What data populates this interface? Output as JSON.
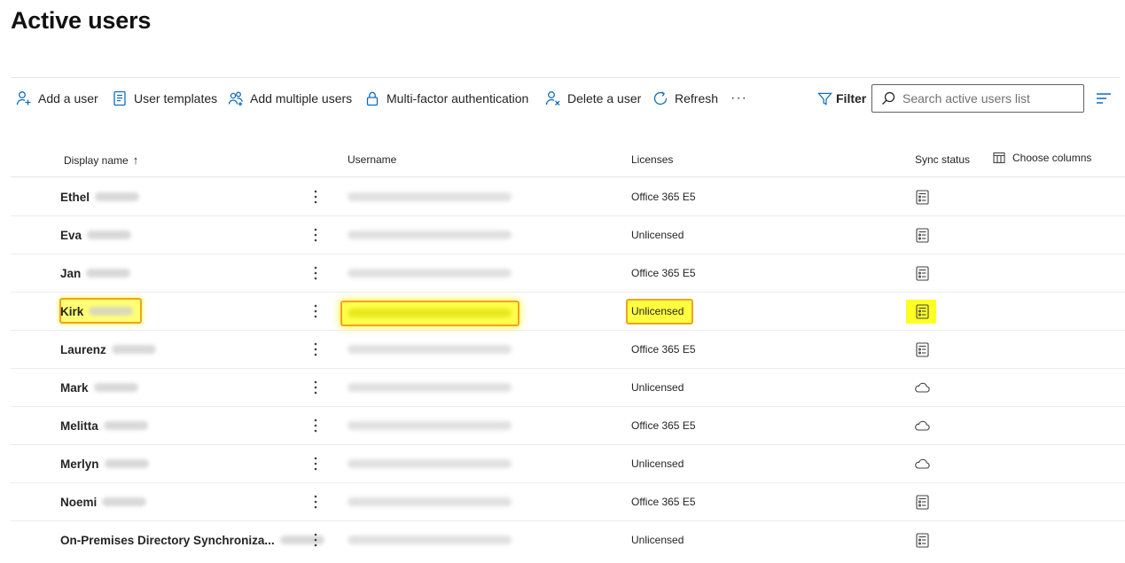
{
  "page": {
    "title": "Active users"
  },
  "toolbar": {
    "add_user": {
      "label": "Add a user",
      "icon": "add-person-icon"
    },
    "user_templates": {
      "label": "User templates",
      "icon": "template-icon"
    },
    "add_multiple": {
      "label": "Add multiple users",
      "icon": "people-add-icon"
    },
    "mfa": {
      "label": "Multi-factor authentication",
      "icon": "lock-icon"
    },
    "delete_user": {
      "label": "Delete a user",
      "icon": "person-delete-icon"
    },
    "refresh": {
      "label": "Refresh",
      "icon": "refresh-icon"
    },
    "more": {
      "label": "···",
      "icon": "more-icon"
    },
    "filter": {
      "label": "Filter",
      "icon": "filter-icon"
    },
    "search": {
      "placeholder": "Search active users list",
      "value": ""
    },
    "view": {
      "icon": "list-view-icon"
    }
  },
  "table": {
    "columns": {
      "display_name": "Display name",
      "sort_indicator": "↑",
      "username": "Username",
      "licenses": "Licenses",
      "sync_status": "Sync status",
      "choose_columns": "Choose columns"
    },
    "rows": [
      {
        "name": "Ethel",
        "license": "Office 365 E5",
        "sync": "directory-synced-icon",
        "highlighted": false
      },
      {
        "name": "Eva",
        "license": "Unlicensed",
        "sync": "directory-synced-icon",
        "highlighted": false
      },
      {
        "name": "Jan",
        "license": "Office 365 E5",
        "sync": "directory-synced-icon",
        "highlighted": false
      },
      {
        "name": "Kirk",
        "license": "Unlicensed",
        "sync": "directory-synced-icon",
        "highlighted": true
      },
      {
        "name": "Laurenz",
        "license": "Office 365 E5",
        "sync": "directory-synced-icon",
        "highlighted": false
      },
      {
        "name": "Mark",
        "license": "Unlicensed",
        "sync": "cloud-icon",
        "highlighted": false
      },
      {
        "name": "Melitta",
        "license": "Office 365 E5",
        "sync": "cloud-icon",
        "highlighted": false
      },
      {
        "name": "Merlyn",
        "license": "Unlicensed",
        "sync": "cloud-icon",
        "highlighted": false
      },
      {
        "name": "Noemi",
        "license": "Office 365 E5",
        "sync": "directory-synced-icon",
        "highlighted": false
      },
      {
        "name": "On-Premises Directory Synchroniza...",
        "license": "Unlicensed",
        "sync": "directory-synced-icon",
        "highlighted": false
      }
    ]
  },
  "colors": {
    "highlight": "#ffff00",
    "highlight_border": "#f0a419",
    "accent": "#0f6cbd"
  }
}
